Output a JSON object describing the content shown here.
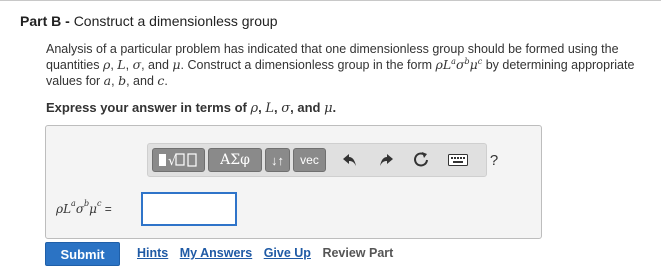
{
  "header": {
    "part_label": "Part B",
    "separator": " - ",
    "title": "Construct a dimensionless group"
  },
  "problem": {
    "t1": "Analysis of a particular problem has indicated that one dimensionless group should be formed using the quantities ",
    "v_rho": "ρ",
    "c1": ", ",
    "v_L": "L",
    "c2": ", ",
    "v_sigma": "σ",
    "c3": ", and ",
    "v_mu": "μ",
    "t2": ". Construct a dimensionless group in the form ",
    "form": {
      "rho": "ρ",
      "L": "L",
      "a": "a",
      "sigma": "σ",
      "b": "b",
      "mu": "μ",
      "c": "c"
    },
    "t3": " by determining appropriate values for ",
    "p_a": "a",
    "c4": ", ",
    "p_b": "b",
    "c5": ", and ",
    "p_c": "c",
    "t4": "."
  },
  "instruction": {
    "text": "Express your answer in terms of ",
    "v_rho": "ρ",
    "c1": ", ",
    "v_L": "L",
    "c2": ", ",
    "v_sigma": "σ",
    "c3": ", and ",
    "v_mu": "μ",
    "end": "."
  },
  "toolbar": {
    "templates_icon": "templates-icon",
    "greek_label": "ΑΣφ",
    "arrows_label": "↓↑",
    "vec_label": "vec",
    "undo_icon": "undo-icon",
    "redo_icon": "redo-icon",
    "reset_icon": "reset-icon",
    "keyboard_icon": "keyboard-icon",
    "help_label": "?"
  },
  "answer": {
    "rho": "ρ",
    "L": "L",
    "a": "a",
    "sigma": "σ",
    "b": "b",
    "mu": "μ",
    "c": "c",
    "equals": " =",
    "value": ""
  },
  "actions": {
    "submit_label": "Submit",
    "hints_label": "Hints",
    "my_answers_label": "My Answers",
    "give_up_label": "Give Up",
    "review_part_label": "Review Part"
  },
  "colors": {
    "submit": "#2b73c4",
    "link": "#1f5aa5",
    "input_border": "#2f74c9"
  }
}
